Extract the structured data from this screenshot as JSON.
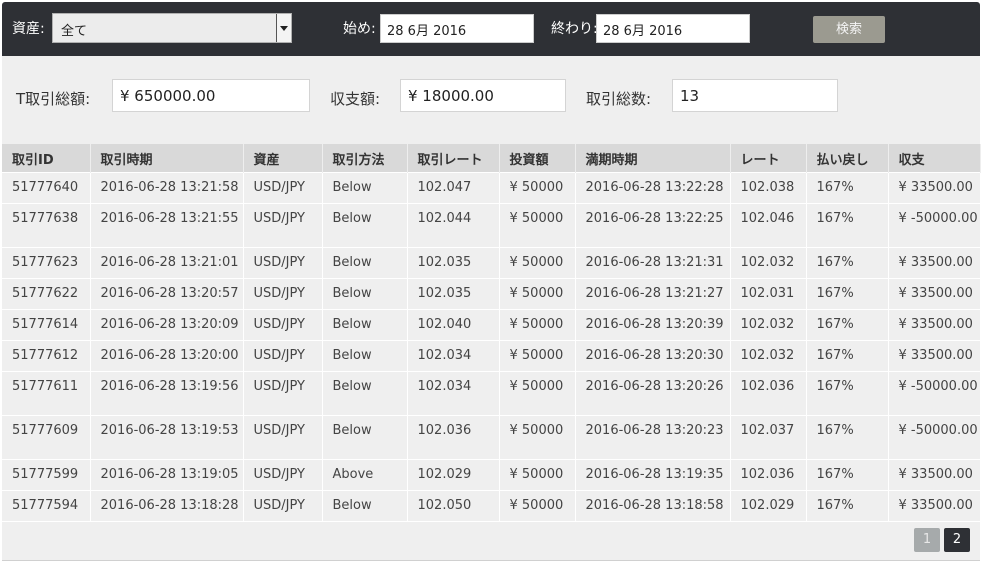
{
  "filters": {
    "asset_label": "資産:",
    "asset_value": "全て",
    "start_label": "始め:",
    "start_value": "28 6月 2016",
    "end_label": "終わり:",
    "end_value": "28 6月 2016",
    "search_label": "検索"
  },
  "summary": {
    "total_label": "T取引総額:",
    "total_value": "¥ 650000.00",
    "balance_label": "収支額:",
    "balance_value": "¥ 18000.00",
    "count_label": "取引総数:",
    "count_value": "13"
  },
  "table": {
    "headers": [
      "取引ID",
      "取引時期",
      "資産",
      "取引方法",
      "取引レート",
      "投資額",
      "満期時期",
      "レート",
      "払い戻し",
      "収支"
    ],
    "rows": [
      [
        "51777640",
        "2016-06-28 13:21:58",
        "USD/JPY",
        "Below",
        "102.047",
        "¥ 50000",
        "2016-06-28 13:22:28",
        "102.038",
        "167%",
        "¥ 33500.00"
      ],
      [
        "51777638",
        "2016-06-28 13:21:55",
        "USD/JPY",
        "Below",
        "102.044",
        "¥ 50000",
        "2016-06-28 13:22:25",
        "102.046",
        "167%",
        "¥ -50000.00"
      ],
      [
        "51777623",
        "2016-06-28 13:21:01",
        "USD/JPY",
        "Below",
        "102.035",
        "¥ 50000",
        "2016-06-28 13:21:31",
        "102.032",
        "167%",
        "¥ 33500.00"
      ],
      [
        "51777622",
        "2016-06-28 13:20:57",
        "USD/JPY",
        "Below",
        "102.035",
        "¥ 50000",
        "2016-06-28 13:21:27",
        "102.031",
        "167%",
        "¥ 33500.00"
      ],
      [
        "51777614",
        "2016-06-28 13:20:09",
        "USD/JPY",
        "Below",
        "102.040",
        "¥ 50000",
        "2016-06-28 13:20:39",
        "102.032",
        "167%",
        "¥ 33500.00"
      ],
      [
        "51777612",
        "2016-06-28 13:20:00",
        "USD/JPY",
        "Below",
        "102.034",
        "¥ 50000",
        "2016-06-28 13:20:30",
        "102.032",
        "167%",
        "¥ 33500.00"
      ],
      [
        "51777611",
        "2016-06-28 13:19:56",
        "USD/JPY",
        "Below",
        "102.034",
        "¥ 50000",
        "2016-06-28 13:20:26",
        "102.036",
        "167%",
        "¥ -50000.00"
      ],
      [
        "51777609",
        "2016-06-28 13:19:53",
        "USD/JPY",
        "Below",
        "102.036",
        "¥ 50000",
        "2016-06-28 13:20:23",
        "102.037",
        "167%",
        "¥ -50000.00"
      ],
      [
        "51777599",
        "2016-06-28 13:19:05",
        "USD/JPY",
        "Above",
        "102.029",
        "¥ 50000",
        "2016-06-28 13:19:35",
        "102.036",
        "167%",
        "¥ 33500.00"
      ],
      [
        "51777594",
        "2016-06-28 13:18:28",
        "USD/JPY",
        "Below",
        "102.050",
        "¥ 50000",
        "2016-06-28 13:18:58",
        "102.029",
        "167%",
        "¥ 33500.00"
      ]
    ]
  },
  "pagination": {
    "pages": [
      "1",
      "2"
    ],
    "current": "1"
  }
}
